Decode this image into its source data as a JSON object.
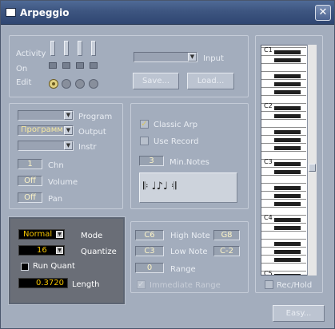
{
  "window": {
    "title": "Arpeggio",
    "close_glyph": "✕"
  },
  "patterns": {
    "activity_label": "Activity",
    "on_label": "On",
    "edit_label": "Edit",
    "selected_radio": 1,
    "radio_count": 4
  },
  "input": {
    "label": "Input",
    "value": "",
    "save_label": "Save...",
    "load_label": "Load..."
  },
  "output": {
    "program_label": "Program",
    "program_value": "",
    "output_label": "Output",
    "output_value": "Программ",
    "instr_label": "Instr",
    "instr_value": "",
    "chn_label": "Chn",
    "chn_value": "1",
    "volume_label": "Volume",
    "volume_value": "Off",
    "pan_label": "Pan",
    "pan_value": "Off"
  },
  "options": {
    "classic_arp_label": "Classic Arp",
    "classic_arp_checked": true,
    "use_record_label": "Use Record",
    "use_record_checked": false,
    "min_notes_label": "Min.Notes",
    "min_notes_value": "3",
    "pattern_glyph": "𝄆 ♩♪♩ 𝄇"
  },
  "mode": {
    "mode_label": "Mode",
    "mode_value": "Normal",
    "quantize_label": "Quantize",
    "quantize_value": "16",
    "run_quant_label": "Run Quant",
    "run_quant_checked": false,
    "length_label": "Length",
    "length_value": "0.3720"
  },
  "range": {
    "c6_value": "C6",
    "high_note_label": "High Note",
    "high_note_value": "G8",
    "c3_value": "C3",
    "low_note_label": "Low Note",
    "low_note_value": "C-2",
    "range_value": "0",
    "range_label": "Range",
    "immediate_label": "Immediate Range",
    "immediate_checked": true
  },
  "keyboard": {
    "octave_labels": [
      "C1",
      "C2",
      "C3",
      "C4",
      "C5"
    ],
    "rec_hold_label": "Rec/Hold",
    "rec_hold_checked": false
  },
  "footer": {
    "easy_label": "Easy..."
  },
  "colors": {
    "window_bg": "#a3adbd",
    "titlebar": "#3d5580",
    "value_text": "#fbf3c6",
    "dark_panel": "#6a6e77",
    "dark_value": "#f5c400"
  }
}
